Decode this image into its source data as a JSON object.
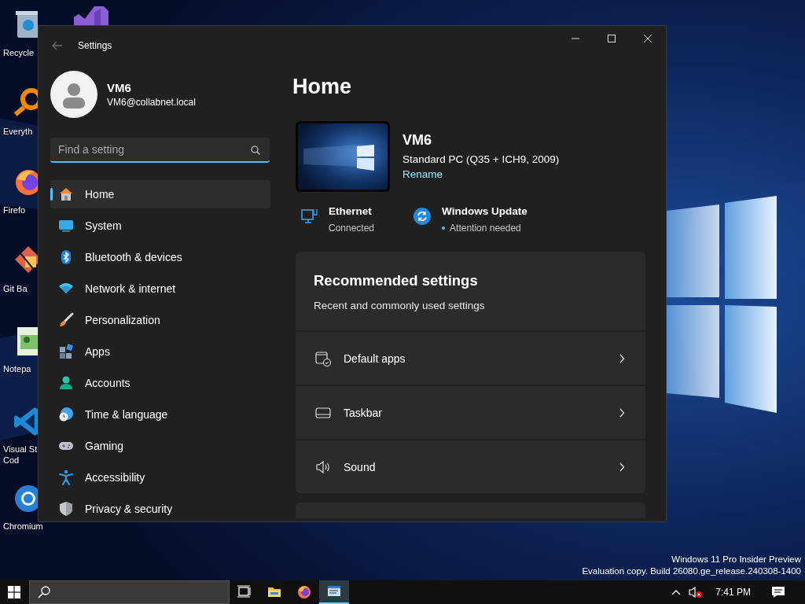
{
  "desktop": {
    "icons": [
      {
        "label_lines": [
          "Recycle"
        ]
      },
      {
        "label_lines": [
          "Everyth"
        ]
      },
      {
        "label_lines": [
          "Firefo"
        ]
      },
      {
        "label_lines": [
          "Git Ba"
        ]
      },
      {
        "label_lines": [
          "Notepa"
        ]
      },
      {
        "label_lines": [
          "Visual St",
          "Cod"
        ]
      },
      {
        "label_lines": [
          "Chromium"
        ]
      }
    ],
    "watermark": [
      "Windows 11 Pro Insider Preview",
      "Evaluation copy. Build 26080.ge_release.240308-1400"
    ]
  },
  "window": {
    "title": "Settings",
    "account": {
      "name": "VM6",
      "email": "VM6@collabnet.local"
    },
    "search": {
      "placeholder": "Find a setting"
    },
    "sidebar": {
      "items": [
        {
          "label": "Home",
          "selected": true
        },
        {
          "label": "System",
          "selected": false
        },
        {
          "label": "Bluetooth & devices",
          "selected": false
        },
        {
          "label": "Network & internet",
          "selected": false
        },
        {
          "label": "Personalization",
          "selected": false
        },
        {
          "label": "Apps",
          "selected": false
        },
        {
          "label": "Accounts",
          "selected": false
        },
        {
          "label": "Time & language",
          "selected": false
        },
        {
          "label": "Gaming",
          "selected": false
        },
        {
          "label": "Accessibility",
          "selected": false
        },
        {
          "label": "Privacy & security",
          "selected": false
        }
      ]
    },
    "page": {
      "heading": "Home",
      "device": {
        "name": "VM6",
        "model": "Standard PC (Q35 + ICH9, 2009)",
        "link": "Rename"
      },
      "status": [
        {
          "title": "Ethernet",
          "detail": "Connected",
          "alert": false
        },
        {
          "title": "Windows Update",
          "detail": "Attention needed",
          "alert": true
        }
      ],
      "recommended": {
        "title": "Recommended settings",
        "subtitle": "Recent and commonly used settings",
        "items": [
          {
            "label": "Default apps"
          },
          {
            "label": "Taskbar"
          },
          {
            "label": "Sound"
          }
        ]
      }
    }
  },
  "taskbar": {
    "apps": [
      {
        "selected": false
      },
      {
        "selected": false
      },
      {
        "selected": false
      },
      {
        "selected": true
      }
    ],
    "clock": "7:41 PM"
  }
}
